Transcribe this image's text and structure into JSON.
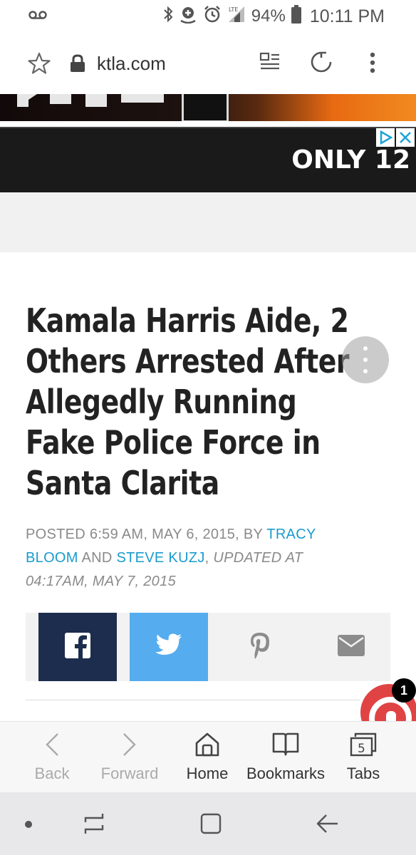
{
  "status_bar": {
    "battery": "94%",
    "time": "10:11 PM",
    "network": "LTE"
  },
  "browser": {
    "url": "ktla.com"
  },
  "ad": {
    "text": "ONLY 12"
  },
  "article": {
    "headline_lines": [
      "Kamala Harris Aide, 2",
      "Others Arrested After",
      "Allegedly Running",
      "Fake Police Force in",
      "Santa Clarita"
    ],
    "byline": {
      "posted": "POSTED 6:59 AM, MAY 6, 2015, BY ",
      "author1_line1": "TRACY",
      "author1_line2": "BLOOM",
      "and": " AND ",
      "author2": "STEVE KUZJ",
      "comma": ", ",
      "updated_line1": "UPDATED AT",
      "updated_line2": "04:17AM, MAY 7, 2015"
    }
  },
  "notification": {
    "count": "1"
  },
  "bottom_nav": {
    "back": "Back",
    "forward": "Forward",
    "home": "Home",
    "bookmarks": "Bookmarks",
    "tabs": "Tabs",
    "tabs_count": "5"
  },
  "colors": {
    "facebook": "#1c2d4e",
    "twitter": "#55acee",
    "link": "#1a9bcf"
  }
}
